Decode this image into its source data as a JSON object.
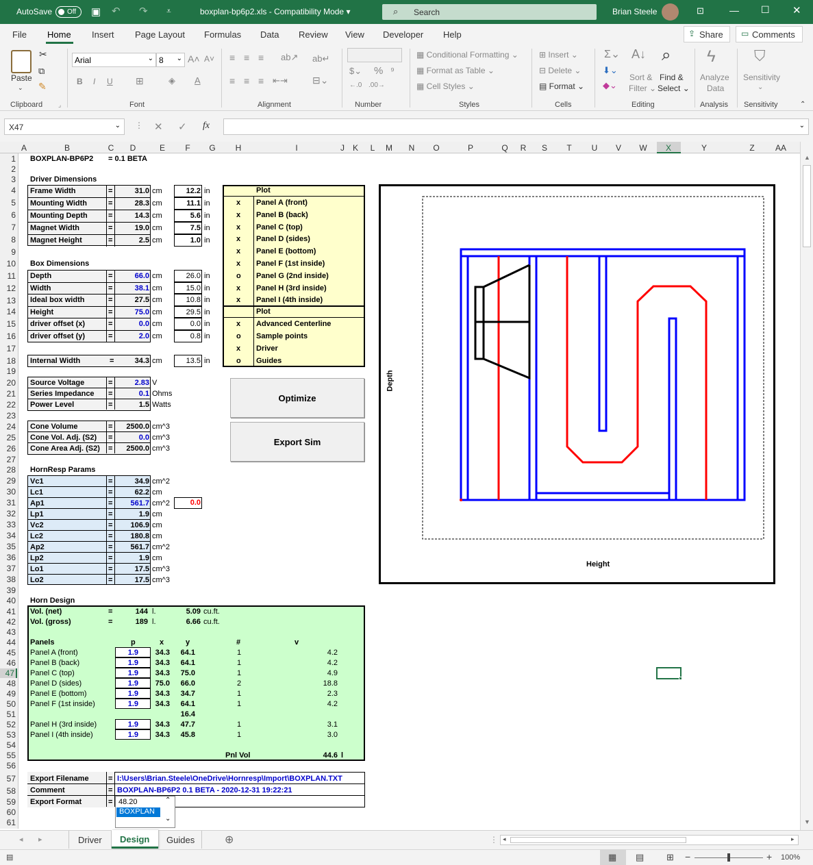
{
  "titlebar": {
    "autosave": "AutoSave",
    "toggle": "Off",
    "filename": "boxplan-bp6p2.xls  -  Compatibility Mode",
    "search_placeholder": "Search",
    "user": "Brian Steele"
  },
  "menu": [
    "File",
    "Home",
    "Insert",
    "Page Layout",
    "Formulas",
    "Data",
    "Review",
    "View",
    "Developer",
    "Help"
  ],
  "share": "Share",
  "comments": "Comments",
  "ribbon": {
    "paste": "Paste",
    "font_name": "Arial",
    "font_size": "8",
    "conditional_formatting": "Conditional Formatting",
    "format_as_table": "Format as Table",
    "cell_styles": "Cell Styles",
    "insert": "Insert",
    "delete": "Delete",
    "format": "Format",
    "sort_filter": "Sort &",
    "sort_filter2": "Filter",
    "find_select": "Find &",
    "find_select2": "Select",
    "analyze": "Analyze",
    "analyze2": "Data",
    "sensitivity": "Sensitivity",
    "groups": [
      "Clipboard",
      "Font",
      "Alignment",
      "Number",
      "Styles",
      "Cells",
      "Editing",
      "Analysis",
      "Sensitivity"
    ]
  },
  "namebox": "X47",
  "columns": [
    "A",
    "B",
    "C",
    "D",
    "E",
    "F",
    "G",
    "H",
    "I",
    "J",
    "K",
    "L",
    "M",
    "N",
    "O",
    "P",
    "Q",
    "R",
    "S",
    "T",
    "U",
    "V",
    "W",
    "X",
    "Y",
    "Z",
    "AA"
  ],
  "sheet": {
    "title": "BOXPLAN-BP6P2",
    "version": "=  0.1 BETA",
    "driver_dims_header": "Driver Dimensions",
    "driver_dims": [
      {
        "label": "Frame Width",
        "cm": "31.0",
        "in": "12.2"
      },
      {
        "label": "Mounting Width",
        "cm": "28.3",
        "in": "11.1"
      },
      {
        "label": "Mounting Depth",
        "cm": "14.3",
        "in": "5.6"
      },
      {
        "label": "Magnet Width",
        "cm": "19.0",
        "in": "7.5"
      },
      {
        "label": "Magnet Height",
        "cm": "2.5",
        "in": "1.0"
      }
    ],
    "box_dims_header": "Box Dimensions",
    "box_dims": [
      {
        "label": "Depth",
        "cm": "66.0",
        "in": "26.0",
        "blue": true
      },
      {
        "label": "Width",
        "cm": "38.1",
        "in": "15.0",
        "blue": true
      },
      {
        "label": "Ideal box width",
        "cm": "27.5",
        "in": "10.8",
        "blue": false
      },
      {
        "label": "Height",
        "cm": "75.0",
        "in": "29.5",
        "blue": true
      },
      {
        "label": "driver offset (x)",
        "cm": "0.0",
        "in": "0.0",
        "blue": true
      },
      {
        "label": "driver offset (y)",
        "cm": "2.0",
        "in": "0.8",
        "blue": true
      }
    ],
    "internal_width": {
      "label": "Internal Width",
      "cm": "34.3",
      "in": "13.5"
    },
    "unit_cm": "cm",
    "unit_in": "in",
    "eq": "=",
    "plot_header": "Plot",
    "plot_items": [
      {
        "mark": "x",
        "label": "Panel A (front)"
      },
      {
        "mark": "x",
        "label": "Panel B (back)"
      },
      {
        "mark": "x",
        "label": "Panel C (top)"
      },
      {
        "mark": "x",
        "label": "Panel D (sides)"
      },
      {
        "mark": "x",
        "label": "Panel E (bottom)"
      },
      {
        "mark": "x",
        "label": "Panel F (1st inside)"
      },
      {
        "mark": "o",
        "label": "Panel G (2nd inside)"
      },
      {
        "mark": "x",
        "label": "Panel H (3rd inside)"
      },
      {
        "mark": "x",
        "label": "Panel I (4th inside)"
      }
    ],
    "plot_items2": [
      {
        "mark": "x",
        "label": "Advanced Centerline"
      },
      {
        "mark": "o",
        "label": "Sample points"
      },
      {
        "mark": "x",
        "label": "Driver"
      },
      {
        "mark": "o",
        "label": "Guides"
      }
    ],
    "source": [
      {
        "label": "Source Voltage",
        "value": "2.83",
        "unit": "V",
        "blue": true
      },
      {
        "label": "Series Impedance",
        "value": "0.1",
        "unit": "Ohms",
        "blue": true
      },
      {
        "label": "Power Level",
        "value": "1.5",
        "unit": "Watts",
        "blue": false
      }
    ],
    "cone": [
      {
        "label": "Cone Volume",
        "value": "2500.0",
        "unit": "cm^3",
        "blue": false
      },
      {
        "label": "Cone Vol. Adj. (S2)",
        "value": "0.0",
        "unit": "cm^3",
        "blue": true
      },
      {
        "label": "Cone Area Adj. (S2)",
        "value": "2500.0",
        "unit": "cm^3",
        "blue": false
      }
    ],
    "optimize": "Optimize",
    "export_sim": "Export Sim",
    "hornresp_header": "HornResp Params",
    "hornresp": [
      {
        "label": "Vc1",
        "value": "34.9",
        "unit": "cm^2",
        "blue": false
      },
      {
        "label": "Lc1",
        "value": "62.2",
        "unit": "cm",
        "blue": false
      },
      {
        "label": "Ap1",
        "value": "561.7",
        "unit": "cm^2",
        "blue": true
      },
      {
        "label": "Lp1",
        "value": "1.9",
        "unit": "cm",
        "blue": false
      },
      {
        "label": "Vc2",
        "value": "106.9",
        "unit": "cm",
        "blue": false
      },
      {
        "label": "Lc2",
        "value": "180.8",
        "unit": "cm",
        "blue": false
      },
      {
        "label": "Ap2",
        "value": "561.7",
        "unit": "cm^2",
        "blue": false
      },
      {
        "label": "Lp2",
        "value": "1.9",
        "unit": "cm",
        "blue": false
      },
      {
        "label": "Lo1",
        "value": "17.5",
        "unit": "cm^3",
        "blue": false
      },
      {
        "label": "Lo2",
        "value": "17.5",
        "unit": "cm^3",
        "blue": false
      }
    ],
    "ap1_extra": "0.0",
    "horn_header": "Horn Design",
    "vol_net": {
      "label": "Vol. (net)",
      "eq": "=",
      "l": "144",
      "lu": "l.",
      "cf": "5.09",
      "cfu": "cu.ft."
    },
    "vol_gross": {
      "label": "Vol. (gross)",
      "eq": "=",
      "l": "189",
      "lu": "l.",
      "cf": "6.66",
      "cfu": "cu.ft."
    },
    "panel_headers": {
      "panels": "Panels",
      "p": "p",
      "x": "x",
      "y": "y",
      "n": "#",
      "v": "v"
    },
    "panels": [
      {
        "label": "Panel A (front)",
        "p": "1.9",
        "x": "34.3",
        "y": "64.1",
        "n": "1",
        "v": "4.2"
      },
      {
        "label": "Panel B (back)",
        "p": "1.9",
        "x": "34.3",
        "y": "64.1",
        "n": "1",
        "v": "4.2"
      },
      {
        "label": "Panel C (top)",
        "p": "1.9",
        "x": "34.3",
        "y": "75.0",
        "n": "1",
        "v": "4.9"
      },
      {
        "label": "Panel D (sides)",
        "p": "1.9",
        "x": "75.0",
        "y": "66.0",
        "n": "2",
        "v": "18.8"
      },
      {
        "label": "Panel E (bottom)",
        "p": "1.9",
        "x": "34.3",
        "y": "34.7",
        "n": "1",
        "v": "2.3"
      },
      {
        "label": "Panel F (1st inside)",
        "p": "1.9",
        "x": "34.3",
        "y": "64.1",
        "n": "1",
        "v": "4.2"
      }
    ],
    "row51_y": "16.4",
    "panels2": [
      {
        "label": "Panel H (3rd inside)",
        "p": "1.9",
        "x": "34.3",
        "y": "47.7",
        "n": "1",
        "v": "3.1"
      },
      {
        "label": "Panel I (4th inside)",
        "p": "1.9",
        "x": "34.3",
        "y": "45.8",
        "n": "1",
        "v": "3.0"
      }
    ],
    "pnl_vol": {
      "label": "Pnl Vol",
      "value": "44.6",
      "unit": "l"
    },
    "export": [
      {
        "label": "Export Filename",
        "value": "I:\\Users\\Brian.Steele\\OneDrive\\Hornresp\\Import\\BOXPLAN.TXT"
      },
      {
        "label": "Comment",
        "value": "BOXPLAN-BP6P2 0.1 BETA - 2020-12-31 19:22:21"
      },
      {
        "label": "Export Format",
        "value": ""
      }
    ],
    "dropdown": [
      "48.20",
      "BOXPLAN"
    ]
  },
  "chart": {
    "xlabel": "Height",
    "ylabel": "Depth",
    "colors": {
      "blue": "#0000ff",
      "red": "#ff0000",
      "black": "#000000"
    }
  },
  "tabs": [
    "Driver",
    "Design",
    "Guides"
  ],
  "active_tab": "Design",
  "zoom": "100%"
}
